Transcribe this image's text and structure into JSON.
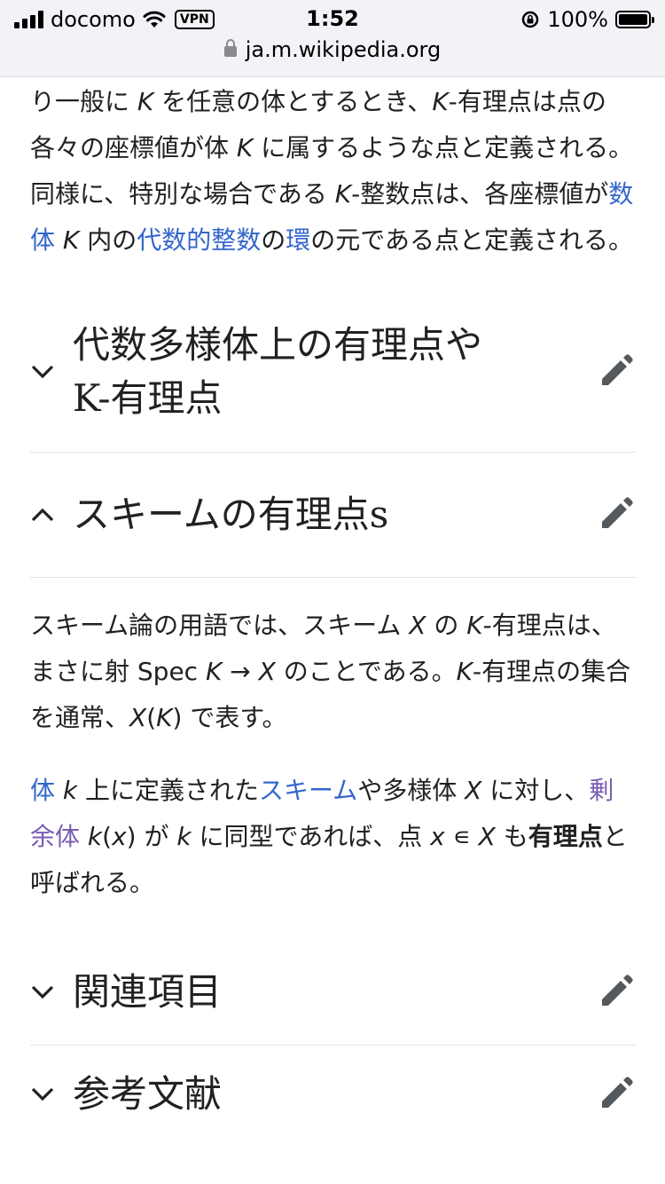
{
  "status_bar": {
    "carrier": "docomo",
    "vpn": "VPN",
    "time": "1:52",
    "battery": "100%"
  },
  "browser": {
    "url": "ja.m.wikipedia.org"
  },
  "article": {
    "intro_paragraph": {
      "t1": "り一般に ",
      "v1": "K",
      "t2": " を任意の体とするとき、",
      "v2": "K",
      "t3": "-有理点は点の各々の座標値が体 ",
      "v3": "K",
      "t4": " に属するような点と定義される。同様に、特別な場合である ",
      "v4": "K",
      "t5": "-整数点は、各座標値が",
      "link1": "数体",
      "t6": " ",
      "v5": "K",
      "t7": " 内の",
      "link2": "代数的整数",
      "t8": "の",
      "link3": "環",
      "t9": "の元である点と定義される。"
    },
    "sections": [
      {
        "heading": "代数多様体上の有理点やK-有理点",
        "heading_line1": "代数多様体上の有理点や",
        "heading_line2": "K-有理点",
        "expanded": false
      },
      {
        "heading": "スキームの有理点s",
        "expanded": true
      },
      {
        "heading": "関連項目",
        "expanded": false
      },
      {
        "heading": "参考文献",
        "expanded": false
      }
    ],
    "scheme_paragraph1": {
      "t1": "スキーム論の用語では、スキーム ",
      "v1": "X",
      "t2": " の ",
      "v2": "K",
      "t3": "-有理点は、まさに射 Spec ",
      "v3": "K",
      "t4": " → ",
      "v4": "X",
      "t5": " のことである。",
      "v5": "K",
      "t6": "-有理点の集合を通常、",
      "v6": "X",
      "t7": "(",
      "v7": "K",
      "t8": ") で表す。"
    },
    "scheme_paragraph2": {
      "link1": "体",
      "t1": " ",
      "v1": "k",
      "t2": " 上に定義された",
      "link2": "スキーム",
      "t3": "や多様体 ",
      "v2": "X",
      "t4": " に対し、",
      "link3": "剰余体",
      "t5": " ",
      "v3": "k",
      "t6": "(",
      "v4": "x",
      "t7": ") が ",
      "v5": "k",
      "t8": " に同型であれば、点 ",
      "v6": "x",
      "t9": " ∊ ",
      "v7": "X",
      "t10": " も",
      "bold": "有理点",
      "t11": "と呼ばれる。"
    }
  },
  "icons": {
    "chevron_down": "chevron-down-icon",
    "chevron_up": "chevron-up-icon",
    "edit": "pencil-icon",
    "lock": "lock-icon",
    "wifi": "wifi-icon",
    "rotation_lock": "rotation-lock-icon"
  },
  "colors": {
    "link": "#3366cc",
    "visited_link": "#795cb2",
    "text": "#202122",
    "icon": "#54595d"
  }
}
